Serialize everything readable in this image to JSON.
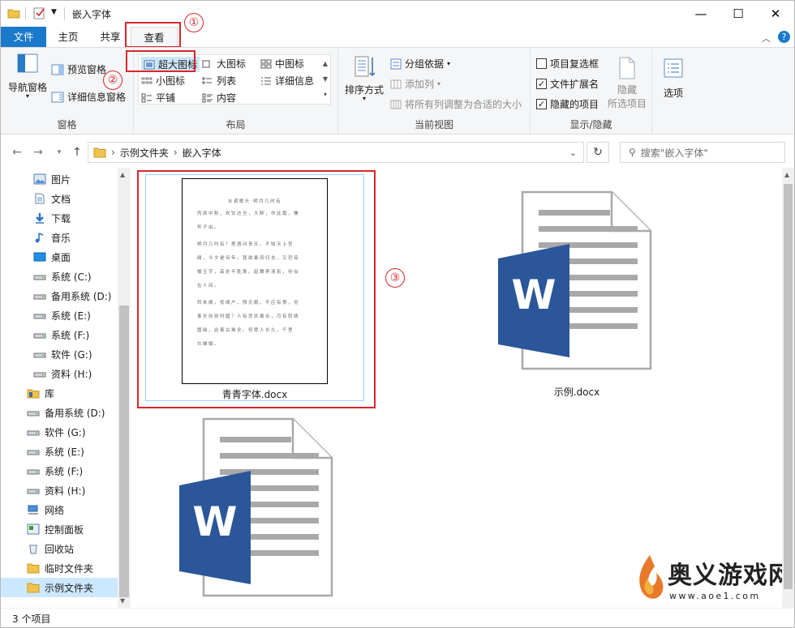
{
  "window": {
    "title": "嵌入字体",
    "minimize": "—",
    "maximize": "☐",
    "close": "✕"
  },
  "ribbon": {
    "tabs": [
      "文件",
      "主页",
      "共享",
      "查看"
    ],
    "active_tab": "查看",
    "groups": {
      "panes": {
        "label": "窗格",
        "nav_pane": "导航窗格",
        "preview_pane": "预览窗格",
        "details_pane": "详细信息窗格"
      },
      "layout": {
        "label": "布局",
        "items": [
          "超大图标",
          "大图标",
          "中图标",
          "小图标",
          "列表",
          "详细信息",
          "平铺",
          "内容"
        ],
        "selected": "超大图标"
      },
      "current_view": {
        "label": "当前视图",
        "sort_by": "排序方式",
        "group_by": "分组依据",
        "add_columns": "添加列",
        "fit_columns": "将所有列调整为合适的大小"
      },
      "show_hide": {
        "label": "显示/隐藏",
        "item_checkboxes": "项目复选框",
        "item_checkboxes_checked": false,
        "file_extensions": "文件扩展名",
        "file_extensions_checked": true,
        "hidden_items": "隐藏的项目",
        "hidden_items_checked": true,
        "hide_selected_line1": "隐藏",
        "hide_selected_line2": "所选项目",
        "options": "选项"
      }
    }
  },
  "address": {
    "crumbs": [
      "示例文件夹",
      "嵌入字体"
    ],
    "search_placeholder": "搜索\"嵌入字体\""
  },
  "nav": {
    "items": [
      {
        "label": "图片",
        "icon": "pictures-icon",
        "indent": 1
      },
      {
        "label": "文档",
        "icon": "documents-icon",
        "indent": 1
      },
      {
        "label": "下载",
        "icon": "downloads-icon",
        "indent": 1
      },
      {
        "label": "音乐",
        "icon": "music-icon",
        "indent": 1
      },
      {
        "label": "桌面",
        "icon": "desktop-icon",
        "indent": 1
      },
      {
        "label": "系统 (C:)",
        "icon": "drive-icon",
        "indent": 1
      },
      {
        "label": "备用系统 (D:)",
        "icon": "drive-icon",
        "indent": 1
      },
      {
        "label": "系统 (E:)",
        "icon": "drive-icon",
        "indent": 1
      },
      {
        "label": "系统 (F:)",
        "icon": "drive-icon",
        "indent": 1
      },
      {
        "label": "软件 (G:)",
        "icon": "drive-icon",
        "indent": 1
      },
      {
        "label": "资料 (H:)",
        "icon": "drive-icon",
        "indent": 1
      },
      {
        "label": "库",
        "icon": "library-icon",
        "indent": 0
      },
      {
        "label": "备用系统 (D:)",
        "icon": "drive-icon",
        "indent": 0
      },
      {
        "label": "软件 (G:)",
        "icon": "drive-icon",
        "indent": 0
      },
      {
        "label": "系统 (E:)",
        "icon": "drive-icon",
        "indent": 0
      },
      {
        "label": "系统 (F:)",
        "icon": "drive-icon",
        "indent": 0
      },
      {
        "label": "资料 (H:)",
        "icon": "drive-icon",
        "indent": 0
      },
      {
        "label": "网络",
        "icon": "network-icon",
        "indent": 0
      },
      {
        "label": "控制面板",
        "icon": "control-panel-icon",
        "indent": 0
      },
      {
        "label": "回收站",
        "icon": "recycle-bin-icon",
        "indent": 0
      },
      {
        "label": "临时文件夹",
        "icon": "folder-icon",
        "indent": 0
      },
      {
        "label": "示例文件夹",
        "icon": "folder-icon",
        "indent": 0,
        "selected": true
      }
    ]
  },
  "files": [
    {
      "name": "青青字体.docx",
      "thumbnail_title": "水调歌头·明月几时有",
      "thumbnail_lines": [
        "丙辰中秋，欢饮达旦，大醉，作此篇，兼",
        "怀子由。",
        "明月几时有？把酒问青天。不知天上宫",
        "阙，今夕是何年。我欲乘风归去，又恐琼",
        "楼玉宇，高处不胜寒。起舞弄清影，何似",
        "在人间。",
        "转朱阁，低绮户，照无眠。不应有恨，何",
        "事长向别时圆？人有悲欢离合，月有阴晴",
        "圆缺，此事古难全。但愿人长久，千里",
        "共婵娟。"
      ]
    },
    {
      "name": "示例.docx"
    },
    {
      "name": ""
    }
  ],
  "status": {
    "count": "3 个项目"
  },
  "annotations": [
    "①",
    "②",
    "③"
  ],
  "watermark": {
    "brand": "奥义游戏网",
    "url": "www.aoe1.com"
  },
  "colors": {
    "accent": "#1979ca",
    "highlight": "#d9262c",
    "word_blue": "#2b579a",
    "selection": "#cce8ff"
  }
}
